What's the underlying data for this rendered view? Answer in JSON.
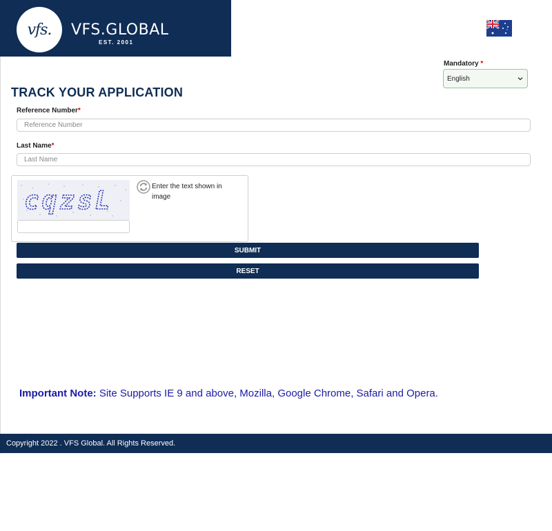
{
  "brand": {
    "logo_text": "vfs.",
    "name": "VFS.GLOBAL",
    "est": "EST. 2001"
  },
  "language": {
    "label": "Mandatory",
    "required_mark": "*",
    "selected": "English"
  },
  "page": {
    "title": "TRACK YOUR APPLICATION"
  },
  "form": {
    "reference": {
      "label": "Reference Number",
      "required_mark": "*",
      "placeholder": "Reference Number"
    },
    "last_name": {
      "label": "Last Name",
      "required_mark": "*",
      "placeholder": "Last Name"
    },
    "captcha": {
      "image_text": "cqzsL",
      "hint": "Enter the text shown in image"
    },
    "submit_label": "SUBMIT",
    "reset_label": "RESET"
  },
  "note": {
    "lead": "Important Note:",
    "text": " Site Supports IE 9 and above, Mozilla, Google Chrome, Safari and Opera."
  },
  "footer": {
    "copyright": "Copyright 2022 . VFS Global. All Rights Reserved."
  },
  "colors": {
    "brand_navy": "#0f2d55",
    "required_red": "#e00000",
    "note_blue": "#1a1aa6"
  },
  "icons": {
    "flag": "uk-au-flag-icon",
    "refresh": "refresh-icon",
    "dropdown": "chevron-down-icon"
  }
}
